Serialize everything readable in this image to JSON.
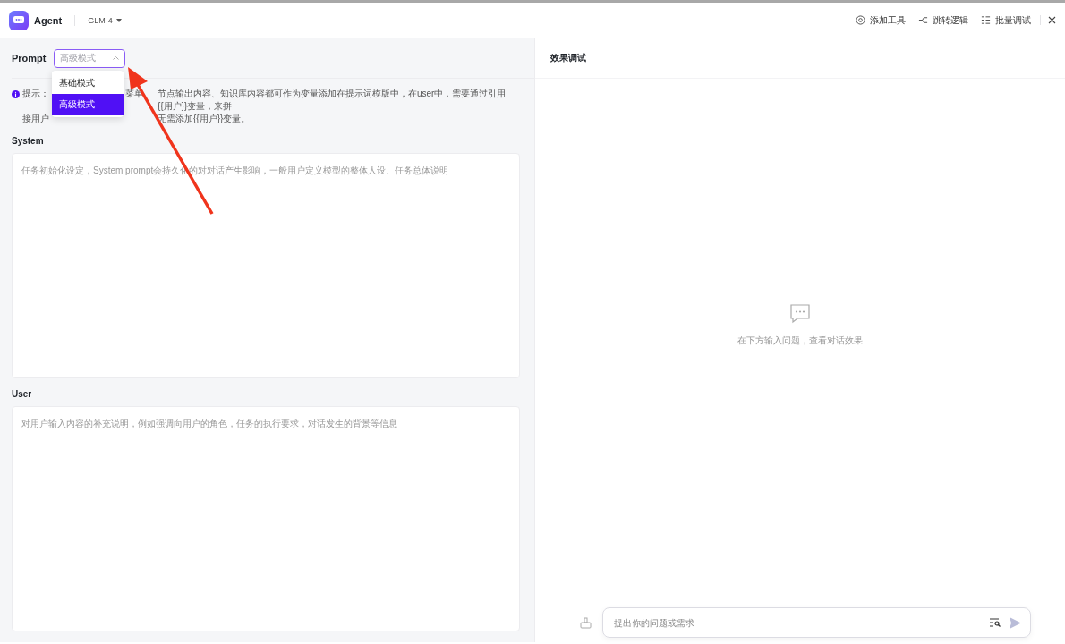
{
  "header": {
    "app_name": "Agent",
    "model": "GLM-4",
    "actions": [
      {
        "kind": "tool",
        "label": "添加工具"
      },
      {
        "kind": "flow",
        "label": "跳转逻辑"
      },
      {
        "kind": "batch",
        "label": "批量调试"
      }
    ]
  },
  "prompt": {
    "title": "Prompt",
    "mode_select": {
      "value": "高级模式",
      "expanded": true,
      "options": [
        {
          "label": "基础模式",
          "selected": false
        },
        {
          "label": "高级模式",
          "selected": true
        }
      ]
    },
    "tip": {
      "label": "提示：",
      "line1_part": "菜单",
      "line1_rest": "节点输出内容、知识库内容都可作为变量添加在提示词模版中，在user中，需要通过引用{{用户}}变量，来拼",
      "line2_start": "接用户",
      "line2_rest": "无需添加{{用户}}变量。"
    },
    "sections": [
      {
        "title": "System",
        "placeholder": "任务初始化设定，System prompt会持久化的对对话产生影响，一般用户定义模型的整体人设、任务总体说明"
      },
      {
        "title": "User",
        "placeholder": "对用户输入内容的补充说明，例如强调向用户的角色，任务的执行要求，对话发生的背景等信息"
      }
    ]
  },
  "debug": {
    "title": "效果调试",
    "empty_text": "在下方输入问题，查看对话效果",
    "input": {
      "placeholder": "提出你的问题或需求"
    }
  },
  "annotation": {
    "kind": "arrow"
  }
}
